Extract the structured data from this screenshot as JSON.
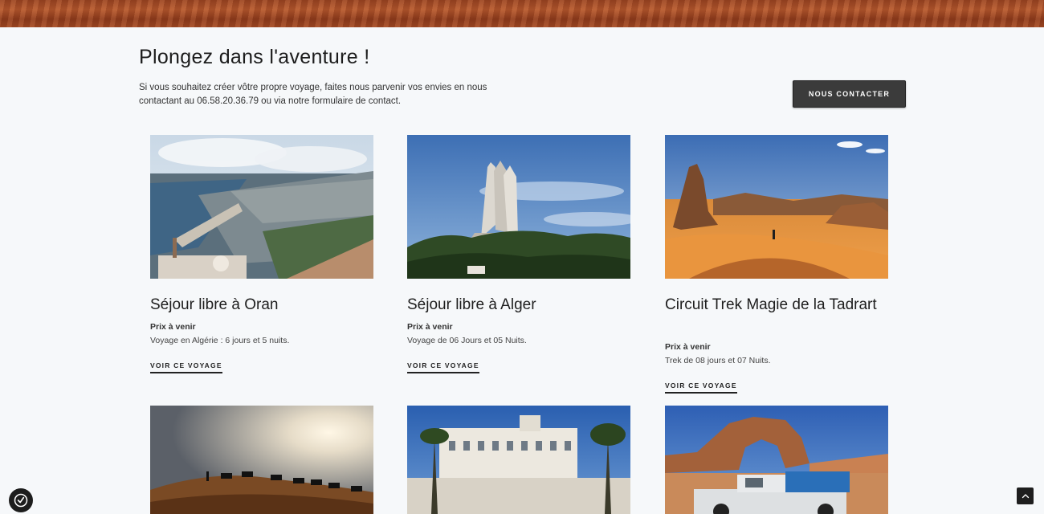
{
  "header": {
    "title": "Plongez dans l'aventure !",
    "intro": "Si vous souhaitez créer vôtre propre voyage, faites nous parvenir vos envies en nous contactant au 06.58.20.36.79 ou via notre formulaire de contact.",
    "contact_label": "NOUS CONTACTER"
  },
  "cards": [
    {
      "title": "Séjour libre à Oran",
      "price": "Prix à venir",
      "desc": "Voyage en Algérie : 6 jours et 5 nuits.",
      "link": "VOIR CE VOYAGE"
    },
    {
      "title": "Séjour libre à Alger",
      "price": "Prix à venir",
      "desc": "Voyage de 06 Jours et 05 Nuits.",
      "link": "VOIR CE VOYAGE"
    },
    {
      "title": "Circuit Trek Magie de la Tadrart",
      "price": "Prix à venir",
      "desc": "Trek de 08 jours et 07 Nuits.",
      "link": "VOIR CE VOYAGE"
    }
  ],
  "icons": {
    "accessibility": "accessibility-icon",
    "scroll_top": "chevron-up-icon"
  }
}
